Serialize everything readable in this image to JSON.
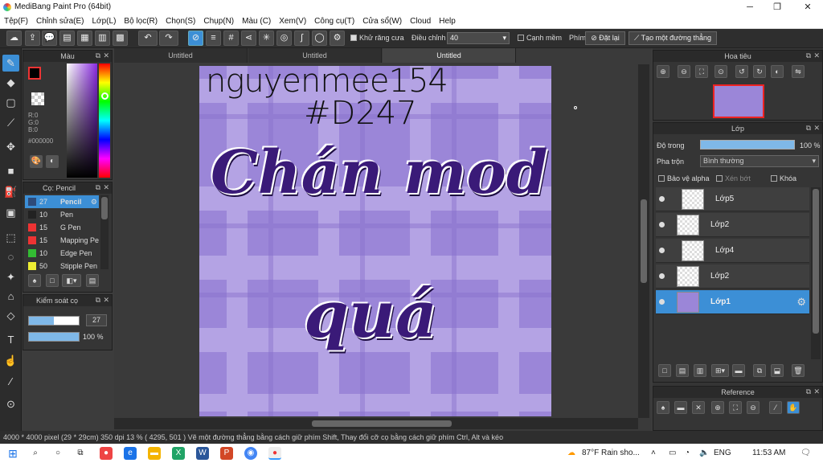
{
  "window": {
    "title": "MediBang Paint Pro (64bit)"
  },
  "menu": [
    "Tệp(F)",
    "Chỉnh sửa(E)",
    "Lớp(L)",
    "Bộ lọc(R)",
    "Chọn(S)",
    "Chụp(N)",
    "Màu (C)",
    "Xem(V)",
    "Công cụ(T)",
    "Cửa sổ(W)",
    "Cloud",
    "Help"
  ],
  "toolbar": {
    "antialias": "Khử răng cưa",
    "adjust": "Điều chỉnh",
    "adjust_value": "40",
    "edge": "Cạnh mềm",
    "key": "Phím",
    "set": "Đặt lại",
    "make_line": "Tạo một đường thẳng"
  },
  "color": {
    "title": "Màu",
    "r": "R:0",
    "g": "G:0",
    "b": "B:0",
    "hex": "#000000"
  },
  "brush": {
    "title": "Cọ: Pencil",
    "items": [
      {
        "size": "27",
        "name": "Pencil",
        "color": "#2e4b7a"
      },
      {
        "size": "10",
        "name": "Pen",
        "color": "#222"
      },
      {
        "size": "15",
        "name": "G Pen",
        "color": "#e33"
      },
      {
        "size": "15",
        "name": "Mapping Pe",
        "color": "#e33"
      },
      {
        "size": "10",
        "name": "Edge Pen",
        "color": "#3b3"
      },
      {
        "size": "50",
        "name": "Stipple Pen",
        "color": "#ee3"
      }
    ]
  },
  "brush_control": {
    "title": "Kiểm soát cọ",
    "size": "27",
    "opacity": "100 %"
  },
  "tabs": [
    "Untitled",
    "Untitled",
    "Untitled"
  ],
  "artwork": {
    "line1": "nguyenmee154",
    "line2": "#D247",
    "big1": "Chán mod",
    "big2": "quá"
  },
  "navigator": {
    "title": "Hoa tiêu"
  },
  "layers": {
    "title": "Lớp",
    "opacity_label": "Độ trong",
    "opacity_value": "100 %",
    "blend_label": "Pha trộn",
    "blend_value": "Bình thường",
    "protect_alpha": "Bảo vệ alpha",
    "clipping": "Xén bớt",
    "lock": "Khóa",
    "items": [
      {
        "name": "Lớp5"
      },
      {
        "name": "Lớp2"
      },
      {
        "name": "Lớp4"
      },
      {
        "name": "Lớp2"
      },
      {
        "name": "Lớp1"
      }
    ]
  },
  "reference": {
    "title": "Reference"
  },
  "status": {
    "text": "4000 * 4000 pixel   (29 * 29cm)   350 dpi   13 %   ( 4295, 501 )   Vẽ một đường thẳng bằng cách giữ phím Shift, Thay đổi cỡ cọ bằng cách giữ phím Ctrl, Alt và kéo"
  },
  "taskbar": {
    "weather": "87°F  Rain sho...",
    "lang": "ENG",
    "time": "11:53 AM"
  }
}
